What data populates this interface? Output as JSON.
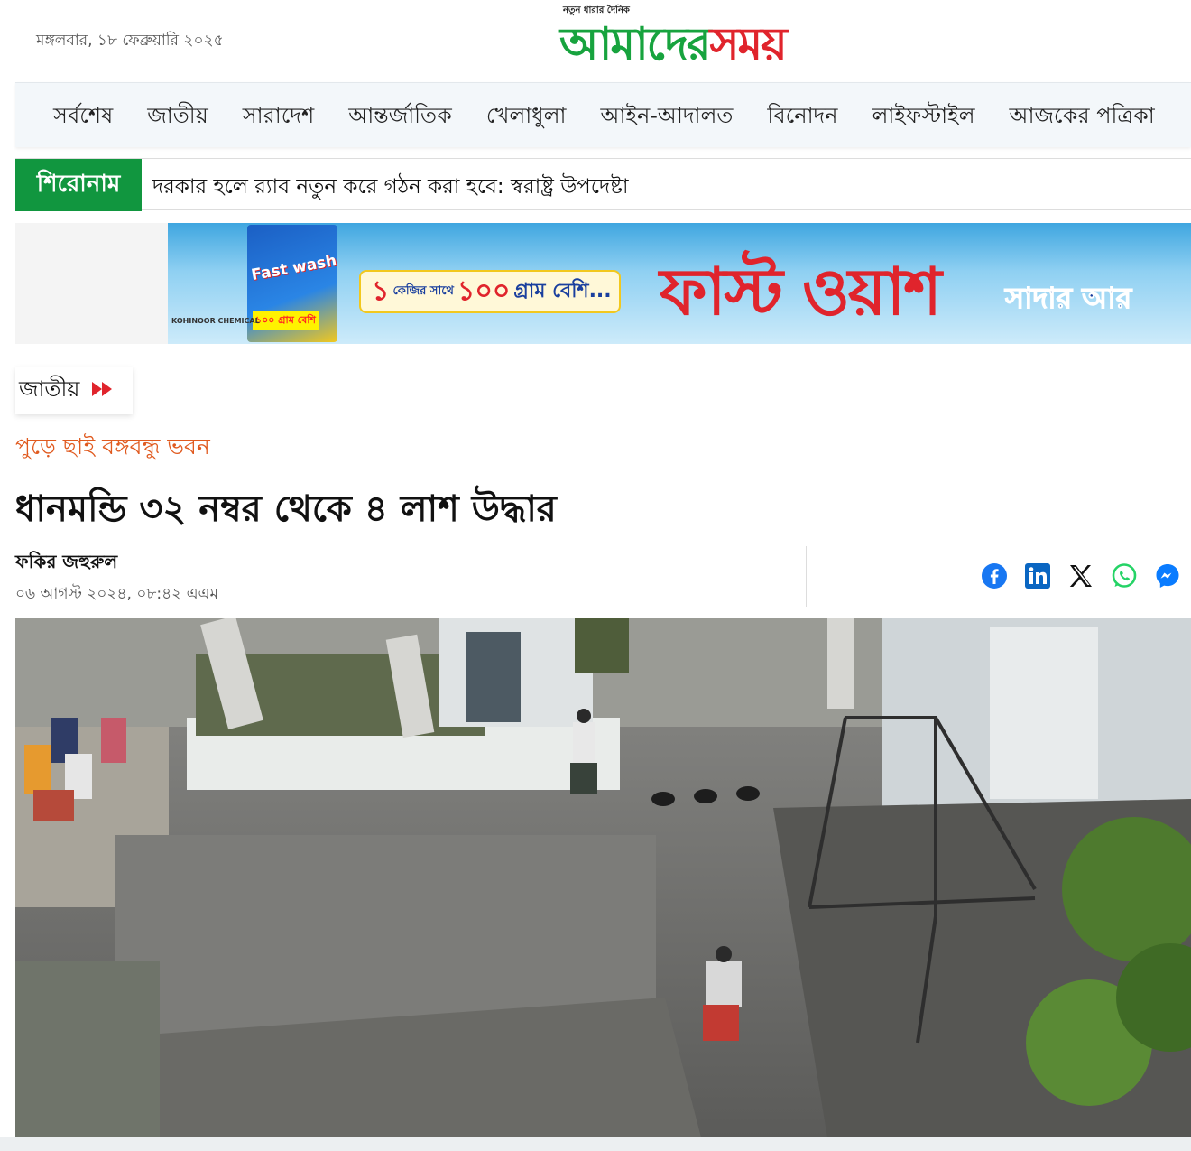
{
  "header": {
    "date": "মঙ্গলবার, ১৮ ফেব্রুয়ারি ২০২৫",
    "logo_tagline": "নতুন ধারার দৈনিক",
    "logo_part1": "আমাদের",
    "logo_part2": "সময়",
    "colors": {
      "green": "#17a33e",
      "red": "#e0242c"
    }
  },
  "nav": {
    "items": [
      "সর্বশেষ",
      "জাতীয়",
      "সারাদেশ",
      "আন্তর্জাতিক",
      "খেলাধুলা",
      "আইন-আদালত",
      "বিনোদন",
      "লাইফস্টাইল",
      "আজকের পত্রিকা"
    ]
  },
  "ticker": {
    "label": "শিরোনাম",
    "text": "দরকার হলে র‌্যাব নতুন করে গঠন করা হবে: স্বরাষ্ট্র উপদেষ্টা"
  },
  "ad": {
    "pack_label": "Fast wash",
    "pack_badge": "১০০ গ্রাম বেশি",
    "brand": "KOHINOOR CHEMICAL",
    "offer_small1": "১",
    "offer_small2": "কেজির সাথে",
    "offer_num": "১০০",
    "offer_rest": "গ্রাম বেশি...",
    "title": "ফাস্ট ওয়াশ",
    "subtitle": "সাদার আর"
  },
  "article": {
    "category": "জাতীয়",
    "category_icon": "fast-forward-icon",
    "kicker": "পুড়ে ছাই বঙ্গবন্ধু ভবন",
    "headline": "ধানমন্ডি ৩২ নম্বর থেকে ৪ লাশ উদ্ধার",
    "author": "ফকির জহুরুল",
    "published": "০৬ আগস্ট ২০২৪, ০৮:৪২ এএম"
  },
  "share": {
    "icons": [
      "facebook-icon",
      "linkedin-icon",
      "x-icon",
      "whatsapp-icon",
      "messenger-icon"
    ],
    "colors": {
      "facebook": "#1877f2",
      "linkedin": "#0a66c2",
      "x": "#111111",
      "whatsapp": "#25d366",
      "messenger": "#0a7cff"
    }
  }
}
